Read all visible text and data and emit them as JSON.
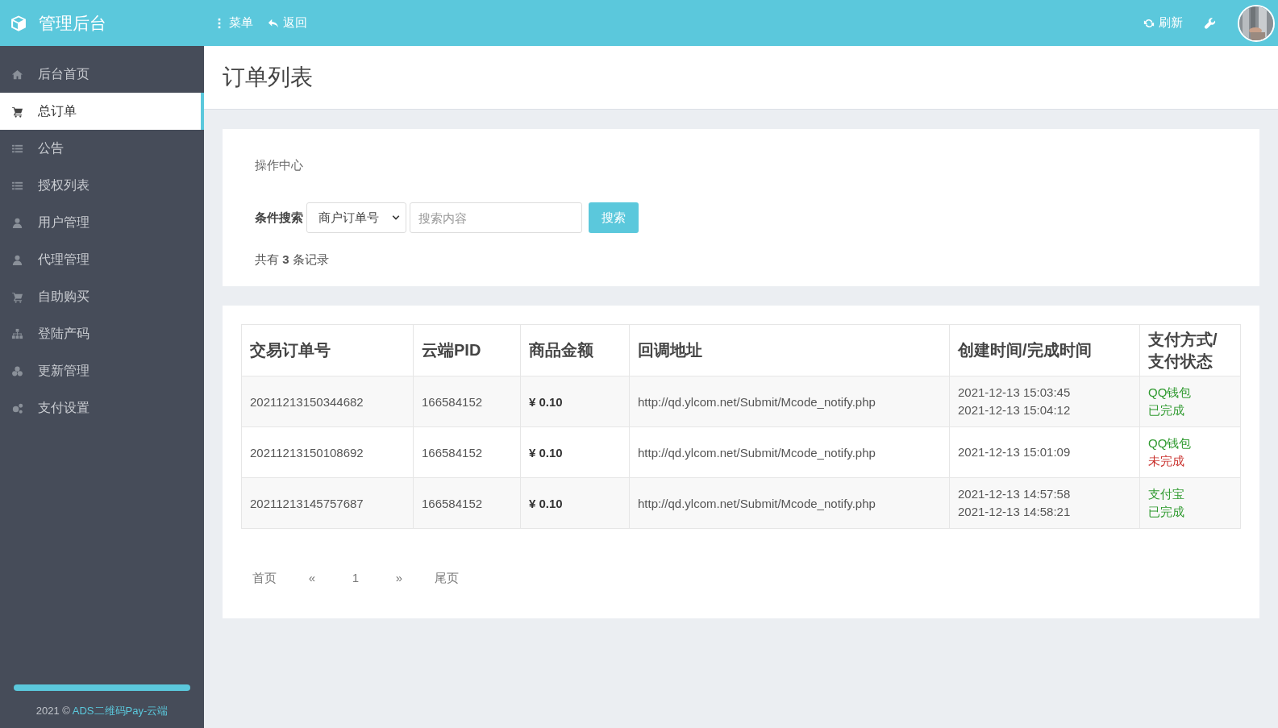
{
  "header": {
    "brand": "管理后台",
    "nav": [
      {
        "label": "菜单",
        "kind": "menu"
      },
      {
        "label": "返回",
        "kind": "back"
      }
    ],
    "actions": [
      {
        "label": "刷新",
        "kind": "refresh"
      },
      {
        "kind": "tools"
      }
    ]
  },
  "sidebar": {
    "items": [
      {
        "label": "后台首页",
        "selected": false
      },
      {
        "label": "总订单",
        "selected": true
      },
      {
        "label": "公告",
        "selected": false
      },
      {
        "label": "授权列表",
        "selected": false
      },
      {
        "label": "用户管理",
        "selected": false
      },
      {
        "label": "代理管理",
        "selected": false
      },
      {
        "label": "自助购买",
        "selected": false
      },
      {
        "label": "登陆产码",
        "selected": false
      },
      {
        "label": "更新管理",
        "selected": false
      },
      {
        "label": "支付设置",
        "selected": false
      }
    ],
    "progress": {
      "level": 1
    },
    "footer": {
      "text": "2021 ©",
      "link": "ADS二维码Pay-云端"
    }
  },
  "page": {
    "title": "订单列表"
  },
  "search_panel": {
    "heading": "操作中心",
    "label": "条件搜索",
    "select_value": "商户订单号",
    "placeholder": "搜索内容",
    "button": "搜索",
    "summary": "共有 **3** 条记录"
  },
  "table": {
    "columns": [
      "交易订单号",
      "云端PID",
      "商品金额",
      "回调地址",
      "创建时间/完成时间",
      "支付方式/支付状态"
    ],
    "rows": [
      {
        "order": "20211213150344682",
        "pid": "166584152",
        "amount": "¥ 0.10",
        "callback": "http://qd.ylcom.net/Submit/Mcode_notify.php",
        "times": [
          "2021-12-13 15:03:45",
          "2021-12-13 15:04:12"
        ],
        "method": "QQ钱包",
        "status": "已完成",
        "done": true
      },
      {
        "order": "20211213150108692",
        "pid": "166584152",
        "amount": "¥ 0.10",
        "callback": "http://qd.ylcom.net/Submit/Mcode_notify.php",
        "times": [
          "2021-12-13 15:01:09"
        ],
        "method": "QQ钱包",
        "status": "未完成",
        "done": false
      },
      {
        "order": "20211213145757687",
        "pid": "166584152",
        "amount": "¥ 0.10",
        "callback": "http://qd.ylcom.net/Submit/Mcode_notify.php",
        "times": [
          "2021-12-13 14:57:58",
          "2021-12-13 14:58:21"
        ],
        "method": "支付宝",
        "status": "已完成",
        "done": true
      }
    ]
  },
  "pagination": [
    "首页",
    "«",
    "1",
    "»",
    "尾页"
  ]
}
